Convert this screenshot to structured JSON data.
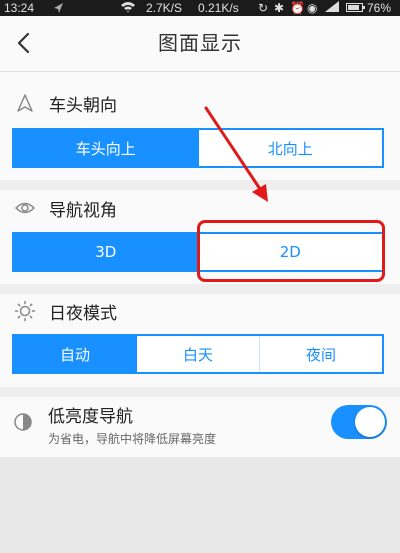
{
  "status_bar": {
    "time": "13:24",
    "speed_down": "2.7K/S",
    "speed_up": "0.21K/s",
    "battery": "76%"
  },
  "header": {
    "title": "图面显示",
    "back_icon": "chevron-left-icon"
  },
  "sections": {
    "heading": {
      "label": "车头朝向",
      "icon": "navigation-arrow-icon",
      "options": [
        "车头向上",
        "北向上"
      ],
      "selected": "车头向上"
    },
    "view_angle": {
      "label": "导航视角",
      "icon": "eye-icon",
      "options": [
        "3D",
        "2D"
      ],
      "selected": "3D"
    },
    "day_night": {
      "label": "日夜模式",
      "icon": "sun-icon",
      "options": [
        "自动",
        "白天",
        "夜间"
      ],
      "selected": "自动"
    },
    "low_brightness": {
      "label": "低亮度导航",
      "description": "为省电，导航中将降低屏幕亮度",
      "icon": "brightness-half-icon",
      "enabled": true
    }
  },
  "colors": {
    "accent": "#1890ff",
    "annotation": "#e01919"
  }
}
